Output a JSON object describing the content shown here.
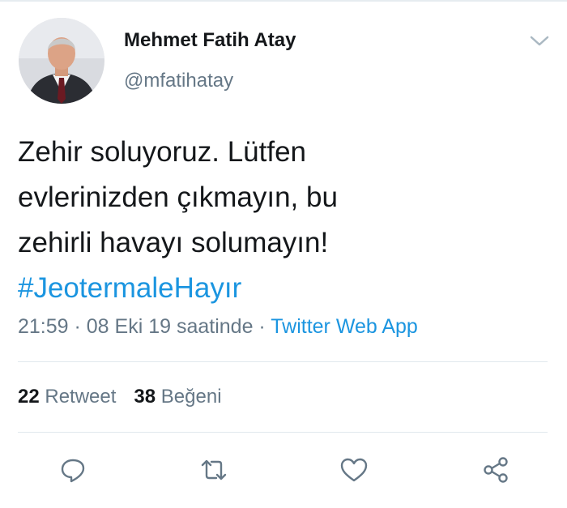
{
  "tweet": {
    "author_name": "Mehmet Fatih Atay",
    "author_handle": "@mfatihatay",
    "text_lines": [
      "Zehir soluyoruz. Lütfen",
      "evlerinizden çıkmayın, bu",
      "zehirli havayı solumayın!"
    ],
    "hashtag": "#JeotermaleHayır",
    "timestamp": "21:59 · 08 Eki 19 saatinde",
    "separator": " · ",
    "source": "Twitter Web App"
  },
  "stats": {
    "retweets_count": "22",
    "retweets_label": "Retweet",
    "likes_count": "38",
    "likes_label": "Beğeni"
  },
  "icons": {
    "reply": "reply-icon",
    "retweet": "retweet-icon",
    "like": "heart-icon",
    "share": "share-icon",
    "more": "chevron-down-icon"
  },
  "colors": {
    "link": "#1b95e0",
    "secondary_text": "#657786",
    "primary_text": "#14171a",
    "divider": "#e1e8ed"
  }
}
